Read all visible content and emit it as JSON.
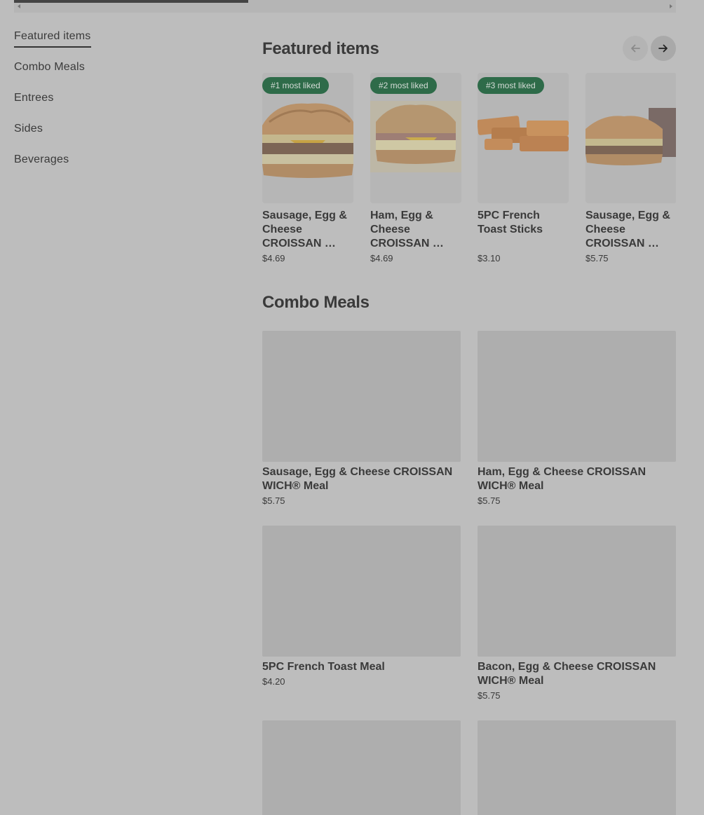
{
  "sidebar": {
    "items": [
      {
        "label": "Featured items"
      },
      {
        "label": "Combo Meals"
      },
      {
        "label": "Entrees"
      },
      {
        "label": "Sides"
      },
      {
        "label": "Beverages"
      }
    ]
  },
  "featured": {
    "title": "Featured items",
    "items": [
      {
        "badge": "#1 most liked",
        "name": "Sausage, Egg & Cheese CROISSAN …",
        "price": "$4.69"
      },
      {
        "badge": "#2 most liked",
        "name": "Ham, Egg & Cheese CROISSAN …",
        "price": "$4.69"
      },
      {
        "badge": "#3 most liked",
        "name": "5PC French Toast Sticks",
        "price": "$3.10"
      },
      {
        "badge": "",
        "name": "Sausage, Egg & Cheese CROISSAN …",
        "price": "$5.75"
      }
    ]
  },
  "combo": {
    "title": "Combo Meals",
    "items": [
      {
        "name": "Sausage, Egg & Cheese CROISSAN WICH® Meal",
        "price": "$5.75"
      },
      {
        "name": "Ham, Egg & Cheese CROISSAN WICH® Meal",
        "price": "$5.75"
      },
      {
        "name": "5PC French Toast Meal",
        "price": "$4.20"
      },
      {
        "name": "Bacon, Egg & Cheese CROISSAN WICH® Meal",
        "price": "$5.75"
      },
      {
        "name": "",
        "price": ""
      },
      {
        "name": "",
        "price": ""
      }
    ]
  },
  "colors": {
    "background": "#bdbdbd",
    "badge": "#2e6b49",
    "text": "#3a3a3a"
  },
  "icons": {
    "prev": "arrow-left-icon",
    "next": "arrow-right-icon"
  }
}
